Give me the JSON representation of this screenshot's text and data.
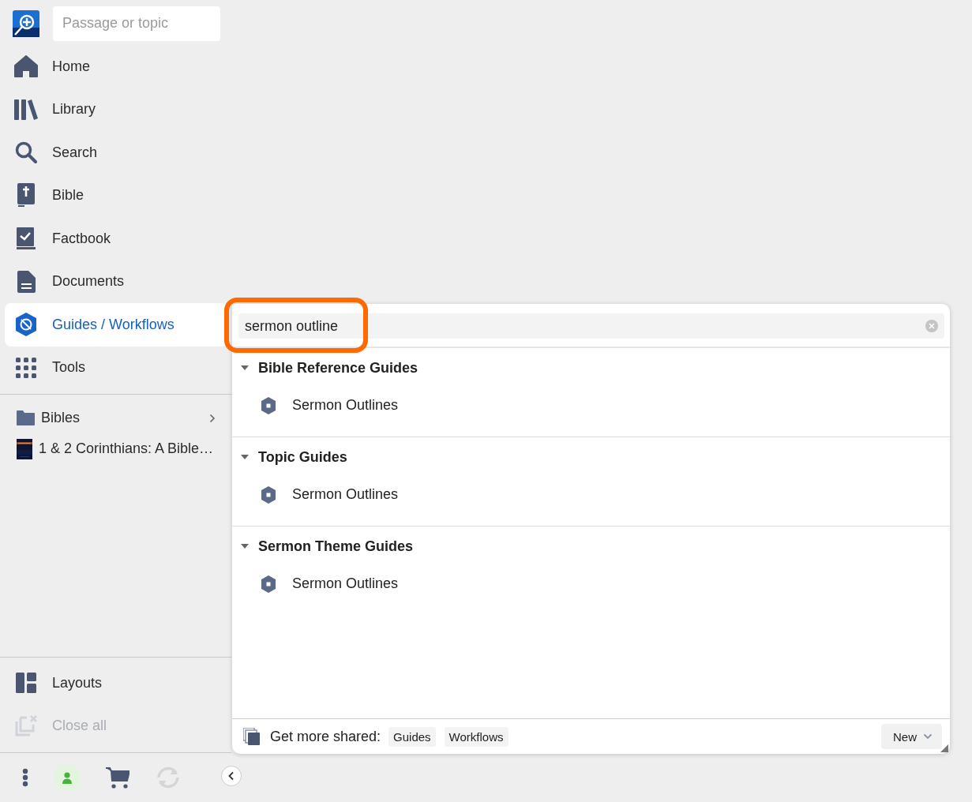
{
  "search": {
    "placeholder": "Passage or topic"
  },
  "nav": [
    {
      "label": "Home",
      "selected": false
    },
    {
      "label": "Library",
      "selected": false
    },
    {
      "label": "Search",
      "selected": false
    },
    {
      "label": "Bible",
      "selected": false
    },
    {
      "label": "Factbook",
      "selected": false
    },
    {
      "label": "Documents",
      "selected": false
    },
    {
      "label": "Guides / Workflows",
      "selected": true
    },
    {
      "label": "Tools",
      "selected": false
    }
  ],
  "collections": [
    {
      "kind": "folder",
      "label": "Bibles"
    },
    {
      "kind": "book",
      "label": "1 & 2 Corinthians: A Bible…"
    }
  ],
  "bottom_nav": [
    {
      "label": "Layouts",
      "disabled": false
    },
    {
      "label": "Close all",
      "disabled": true
    }
  ],
  "toolbar": [
    {
      "kind": "menu"
    },
    {
      "kind": "user"
    },
    {
      "kind": "cart"
    },
    {
      "kind": "sync",
      "disabled": true
    }
  ],
  "guides_panel": {
    "search": {
      "value": "sermon outline",
      "highlighted": true
    },
    "groups": [
      {
        "title": "Bible Reference Guides",
        "expanded": true,
        "items": [
          "Sermon Outlines"
        ]
      },
      {
        "title": "Topic Guides",
        "expanded": true,
        "items": [
          "Sermon Outlines"
        ]
      },
      {
        "title": "Sermon Theme Guides",
        "expanded": true,
        "items": [
          "Sermon Outlines"
        ]
      }
    ],
    "footer": {
      "label": "Get more shared:",
      "links": [
        "Guides",
        "Workflows"
      ],
      "new_button": "New"
    }
  }
}
